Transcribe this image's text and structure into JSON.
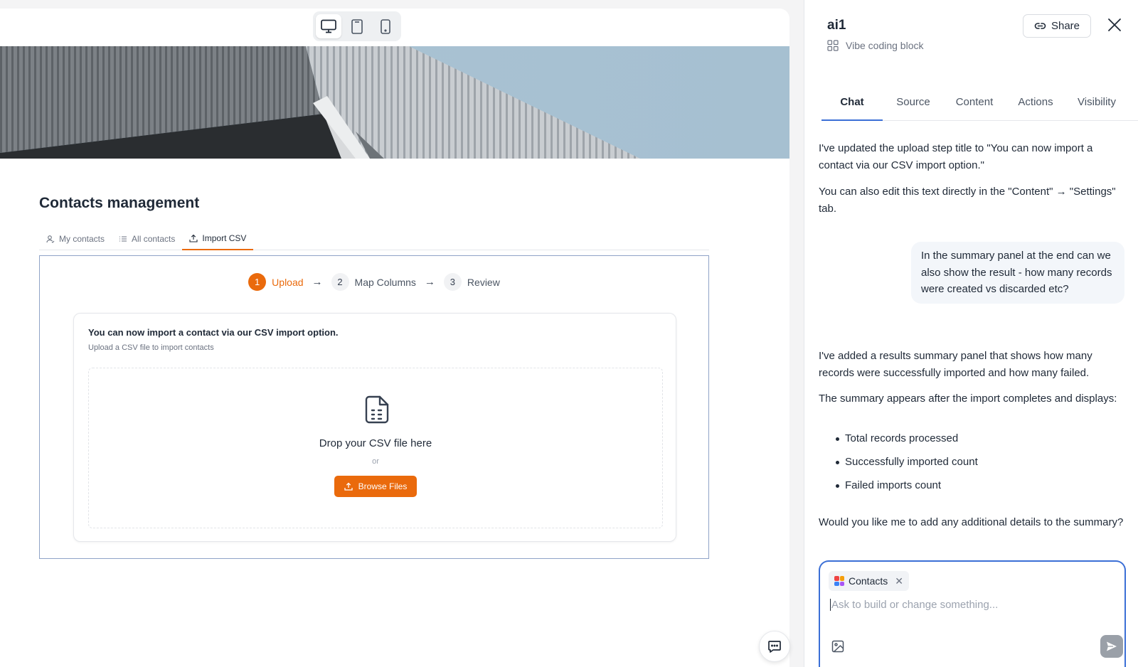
{
  "device_toggle": {
    "options": [
      {
        "name": "desktop",
        "icon": "monitor-icon",
        "active": true
      },
      {
        "name": "tablet",
        "icon": "tablet-icon",
        "active": false
      },
      {
        "name": "mobile",
        "icon": "phone-icon",
        "active": false
      }
    ]
  },
  "app": {
    "title": "Contacts management",
    "tabs": [
      {
        "label": "My contacts",
        "icon": "user-icon"
      },
      {
        "label": "All contacts",
        "icon": "list-icon"
      },
      {
        "label": "Import CSV",
        "icon": "upload-icon",
        "active": true
      }
    ],
    "stepper": [
      {
        "num": "1",
        "label": "Upload",
        "active": true
      },
      {
        "num": "2",
        "label": "Map Columns"
      },
      {
        "num": "3",
        "label": "Review"
      }
    ],
    "upload_card": {
      "title": "You can now import a contact via our CSV import option.",
      "subtitle": "Upload a CSV file to import contacts",
      "drop_text": "Drop your CSV file here",
      "or_text": "or",
      "browse_label": "Browse Files"
    }
  },
  "panel": {
    "title": "ai1",
    "subtitle": "Vibe coding block",
    "share_label": "Share",
    "tabs": [
      {
        "label": "Chat",
        "active": true
      },
      {
        "label": "Source"
      },
      {
        "label": "Content"
      },
      {
        "label": "Actions"
      },
      {
        "label": "Visibility"
      }
    ],
    "messages": {
      "m1": "I've updated the upload step title to \"You can now import a contact via our CSV import option.\"",
      "m2": "You can also edit this text directly in the \"Content\" → \"Settings\" tab.",
      "user": "In the summary panel at the end can we also show the result - how many records were created vs discarded etc?",
      "m3": "I've added a results summary panel that shows how many records were successfully imported and how many failed.",
      "m4": "The summary appears after the import completes and displays:",
      "bullets": [
        "Total records processed",
        "Successfully imported count",
        "Failed imports count"
      ],
      "m5": "Would you like me to add any additional details to the summary?"
    },
    "composer": {
      "chip_label": "Contacts",
      "placeholder": "Ask to build or change something..."
    }
  },
  "colors": {
    "accent_orange": "#ea6a0c",
    "focus_blue": "#3b6fd6"
  }
}
